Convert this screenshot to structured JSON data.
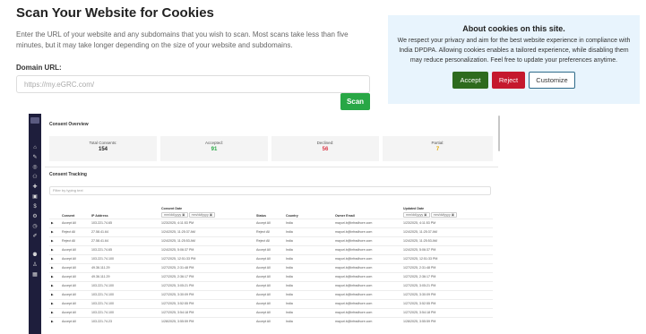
{
  "scanner": {
    "title": "Scan Your Website for Cookies",
    "description": "Enter the URL of your website and any subdomains that you wish to scan. Most scans take less than five minutes, but it may take longer depending on the size of your website and subdomains.",
    "domain_label": "Domain URL:",
    "domain_placeholder": "https://my.eGRC.com/",
    "scan_label": "Scan"
  },
  "cookie_banner": {
    "title": "About cookies on this site.",
    "text": "We respect your privacy and aim for the best website experience in compliance with India DPDPA. Allowing cookies enables a tailored experience, while disabling them may reduce personalization. Feel free to update your preferences anytime.",
    "accept": "Accept",
    "reject": "Reject",
    "customize": "Customize"
  },
  "dashboard": {
    "overview_title": "Consent Overview",
    "stats": [
      {
        "label": "Total Consents:",
        "value": "154",
        "color": "#222222"
      },
      {
        "label": "Accepted:",
        "value": "91",
        "color": "#28a745"
      },
      {
        "label": "Declined:",
        "value": "56",
        "color": "#dc3545"
      },
      {
        "label": "Partial:",
        "value": "7",
        "color": "#e0a800"
      }
    ],
    "tracking_title": "Consent Tracking",
    "filter_placeholder": "Filter by typing text",
    "columns": {
      "consent": "Consent",
      "ip": "IP Address",
      "consent_date": "Consent Date",
      "status": "Status",
      "country": "Country",
      "owner": "Owner Email",
      "updated": "Updated Date"
    },
    "date_placeholder": "mm/dd/yyyy",
    "rows": [
      [
        "Accept All",
        "103.221.74.65",
        "1/23/2025, 4:11:53 PM",
        "Accept All",
        "India",
        "mayuri.b@infradhore.com",
        "1/23/2025, 4:11:53 PM"
      ],
      [
        "Reject All",
        "27.58.41.64",
        "1/24/2025, 11:25:37 AM",
        "Reject All",
        "India",
        "mayuri.b@infradhore.com",
        "1/24/2025, 11:25:37 AM"
      ],
      [
        "Reject All",
        "27.58.41.64",
        "1/24/2025, 11:25:53 AM",
        "Reject All",
        "India",
        "mayuri.b@infradhore.com",
        "1/24/2025, 11:25:53 AM"
      ],
      [
        "Accept All",
        "103.221.74.65",
        "1/24/2025, 5:06:37 PM",
        "Accept All",
        "India",
        "mayuri.b@infradhore.com",
        "1/24/2025, 5:06:37 PM"
      ],
      [
        "Accept All",
        "103.221.74.100",
        "1/27/2025, 12:51:33 PM",
        "Accept All",
        "India",
        "mayuri.b@infradhore.com",
        "1/27/2025, 12:51:33 PM"
      ],
      [
        "Accept All",
        "49.36.111.29",
        "1/27/2025, 2:31:48 PM",
        "Accept All",
        "India",
        "mayuri.b@infradhore.com",
        "1/27/2025, 2:31:48 PM"
      ],
      [
        "Accept All",
        "49.36.111.29",
        "1/27/2025, 2:36:17 PM",
        "Accept All",
        "India",
        "mayuri.b@infradhore.com",
        "1/27/2025, 2:36:17 PM"
      ],
      [
        "Accept All",
        "103.221.74.100",
        "1/27/2025, 3:05:21 PM",
        "Accept All",
        "India",
        "mayuri.b@infradhore.com",
        "1/27/2025, 3:05:21 PM"
      ],
      [
        "Accept All",
        "103.221.74.100",
        "1/27/2025, 3:30:09 PM",
        "Accept All",
        "India",
        "mayuri.b@infradhore.com",
        "1/27/2025, 3:30:09 PM"
      ],
      [
        "Accept All",
        "103.221.74.100",
        "1/27/2025, 3:52:55 PM",
        "Accept All",
        "India",
        "mayuri.b@infradhore.com",
        "1/27/2025, 3:52:55 PM"
      ],
      [
        "Accept All",
        "103.221.74.100",
        "1/27/2025, 3:54:18 PM",
        "Accept All",
        "India",
        "mayuri.b@infradhore.com",
        "1/27/2025, 3:54:18 PM"
      ],
      [
        "Accept All",
        "103.221.74.23",
        "1/28/2025, 3:55:59 PM",
        "Accept All",
        "India",
        "mayuri.b@infradhore.com",
        "1/28/2025, 3:55:59 PM"
      ]
    ]
  }
}
